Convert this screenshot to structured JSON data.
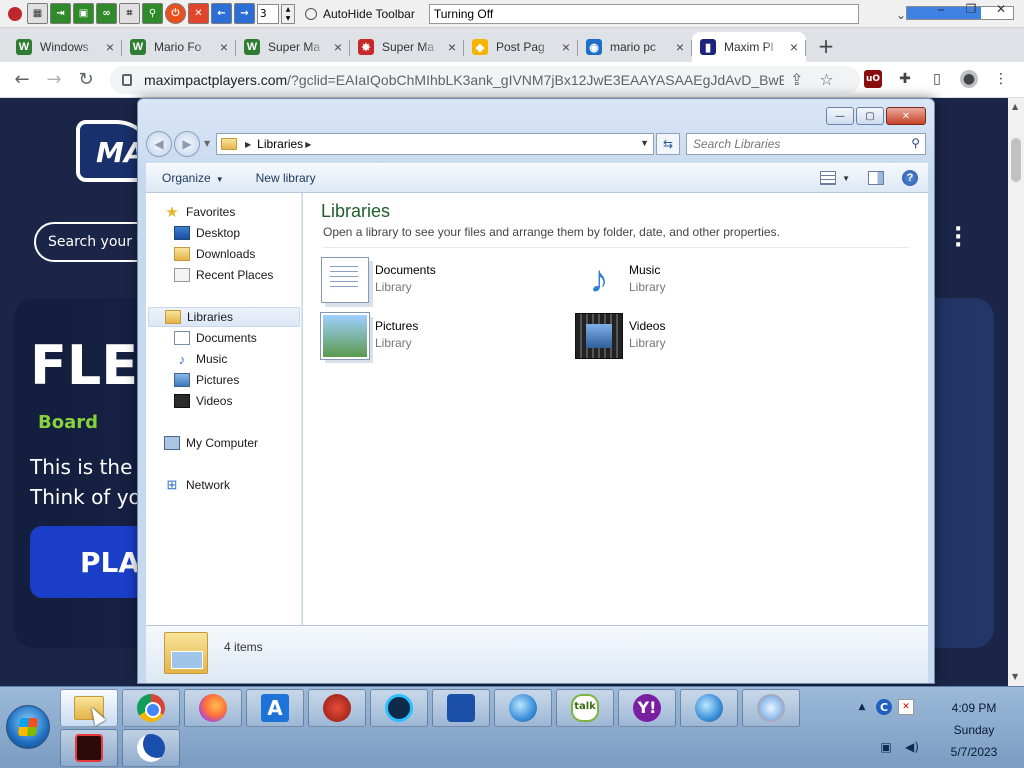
{
  "util_toolbar": {
    "icons": [
      "record-icon",
      "grid-icon",
      "exit-icon",
      "image-icon",
      "binoculars-icon",
      "screenshot-icon",
      "magnifier-icon",
      "power-icon",
      "close-icon",
      "back-arrow-icon",
      "forward-arrow-icon"
    ],
    "counter_value": "3",
    "autohide_label": "AutoHide Toolbar",
    "status_text": "Turning Off",
    "progress_percent": 70,
    "colors": {
      "progress": "#3e82e4",
      "record": "#c0272d"
    }
  },
  "browser": {
    "tabs": [
      {
        "title": "Windows",
        "favicon": "W",
        "favicon_color": "#2e7d32"
      },
      {
        "title": "Mario Fo",
        "favicon": "W",
        "favicon_color": "#2e7d32"
      },
      {
        "title": "Super Ma",
        "favicon": "W",
        "favicon_color": "#2e7d32"
      },
      {
        "title": "Super Ma",
        "favicon": "✸",
        "favicon_color": "#c62828"
      },
      {
        "title": "Post Pag",
        "favicon": "◆",
        "favicon_color": "#f4b400"
      },
      {
        "title": "mario pc",
        "favicon": "◉",
        "favicon_color": "#1e6fc9"
      },
      {
        "title": "Maxim Pl",
        "favicon": "▮",
        "favicon_color": "#1a237e",
        "active": true
      }
    ],
    "new_tab": "+",
    "url": {
      "host": "maximpactplayers.com",
      "rest": "/?gclid=EAIaIQobChMIhbLK3ank_gIVNM7jBx12JwE3EAAYASAAEgJdAvD_BwE#"
    },
    "window_controls": [
      "⎯",
      "❐",
      "✕"
    ]
  },
  "website": {
    "search_placeholder": "Search your f",
    "hero_title": "FLEE",
    "hero_sub": "Board",
    "hero_desc": "This is the c\nThink of yo",
    "play_button": "PLAY"
  },
  "explorer": {
    "caption_buttons": {
      "minimize": "—",
      "maximize": "▢",
      "close": "✕"
    },
    "path_root": "Libraries",
    "search_placeholder": "Search Libraries",
    "commands": {
      "organize": "Organize",
      "new_library": "New library"
    },
    "nav": {
      "favorites": "Favorites",
      "desktop": "Desktop",
      "downloads": "Downloads",
      "recent": "Recent Places",
      "libraries": "Libraries",
      "documents": "Documents",
      "music": "Music",
      "pictures": "Pictures",
      "videos": "Videos",
      "computer": "My Computer",
      "network": "Network"
    },
    "heading": "Libraries",
    "subheading": "Open a library to see your files and arrange them by folder, date, and other properties.",
    "libraries": [
      {
        "name": "Documents",
        "type": "Library"
      },
      {
        "name": "Music",
        "type": "Library"
      },
      {
        "name": "Pictures",
        "type": "Library"
      },
      {
        "name": "Videos",
        "type": "Library"
      }
    ],
    "item_count": "4 items",
    "colors": {
      "heading": "#1e5f2e"
    }
  },
  "taskbar": {
    "apps": [
      "file-explorer",
      "chrome",
      "firefox",
      "a-app",
      "red-swirl-app",
      "ccleaner",
      "blue-app",
      "globe-app",
      "google-talk",
      "yahoo-messenger",
      "globe-app-2",
      "safari",
      "screen-recorder",
      "moon-app"
    ],
    "tb_labels": {
      "atool": "A",
      "talk": "talk",
      "yahoo": "Y!"
    },
    "clock": {
      "time": "4:09 PM",
      "day": "Sunday",
      "date": "5/7/2023"
    }
  }
}
